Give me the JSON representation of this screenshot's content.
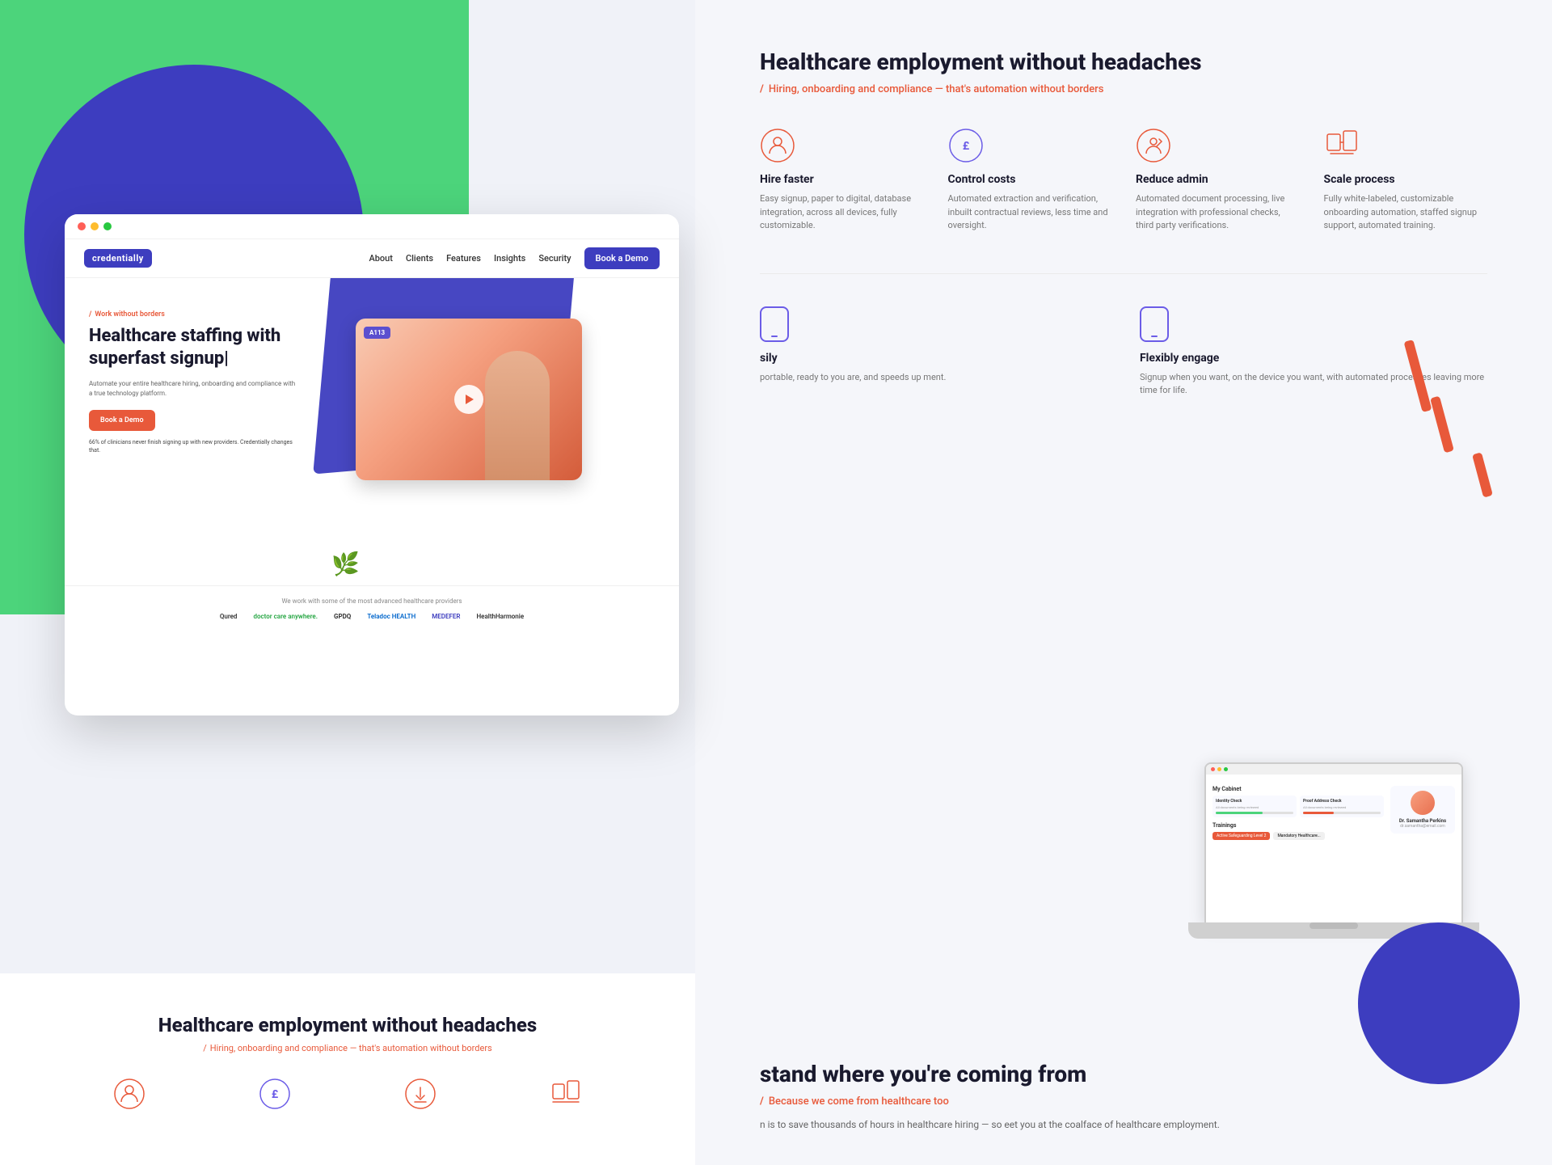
{
  "brand": {
    "logo": "credentially",
    "logoColor": "#3d3dbf"
  },
  "nav": {
    "links": [
      "About",
      "Clients",
      "Features",
      "Insights",
      "Security"
    ],
    "cta": "Book a Demo"
  },
  "hero": {
    "tagline": "Work without borders",
    "title": "Healthcare staffing with superfast signup|",
    "description": "Automate your entire healthcare hiring, onboarding and compliance with a true technology platform.",
    "cta": "Book a Demo",
    "stat": "66% of clinicians never finish signing up with new providers. Credentially changes that.",
    "videoLabel": "A113"
  },
  "partners": {
    "intro": "We work with some of the most advanced healthcare providers",
    "logos": [
      "Qured",
      "doctor care anywhere.",
      "GPDQ",
      "Teladoc HEALTH",
      "MEDEFER",
      "HealthHarmonie"
    ]
  },
  "rightTop": {
    "title": "Healthcare employment without headaches",
    "subtitle": "Hiring, onboarding and compliance — that's automation without borders"
  },
  "features": [
    {
      "title": "Hire faster",
      "desc": "Easy signup, paper to digital, database integration, across all devices, fully customizable.",
      "icon": "person-icon"
    },
    {
      "title": "Control costs",
      "desc": "Automated extraction and verification, inbuilt contractual reviews, less time and oversight.",
      "icon": "pound-icon"
    },
    {
      "title": "Reduce admin",
      "desc": "Automated document processing, live integration with professional checks, third party verifications.",
      "icon": "person-check-icon"
    },
    {
      "title": "Scale process",
      "desc": "Fully white-labeled, customizable onboarding automation, staffed signup support, automated training.",
      "icon": "scale-icon"
    }
  ],
  "engage": {
    "title": "Flexibly engage",
    "desc": "Signup when you want, on the device you want, with automated processes leaving more time for life.",
    "icon": "mobile-icon"
  },
  "sily": {
    "title": "sily",
    "desc": "portable, ready to you are, and speeds up ment."
  },
  "stand": {
    "title": "stand where you're coming from",
    "subtitle": "Because we come from healthcare too",
    "desc": "n is to save thousands of hours in healthcare hiring — so eet you at the coalface of healthcare employment."
  },
  "laptop": {
    "cabinetTitle": "My Cabinet",
    "cards": [
      {
        "title": "Identity Check",
        "sub": "All documents being reviewed"
      },
      {
        "title": "Proof Address Check",
        "sub": "All documents being reviewed"
      }
    ],
    "trainingsTitle": "Trainings",
    "profile": {
      "name": "Dr. Samantha Perkins",
      "detail": "dr.samantha@email.com"
    }
  },
  "bottomSection": {
    "title": "Healthcare employment without headaches",
    "subtitle": "Hiring, onboarding and compliance — that's automation without borders"
  }
}
